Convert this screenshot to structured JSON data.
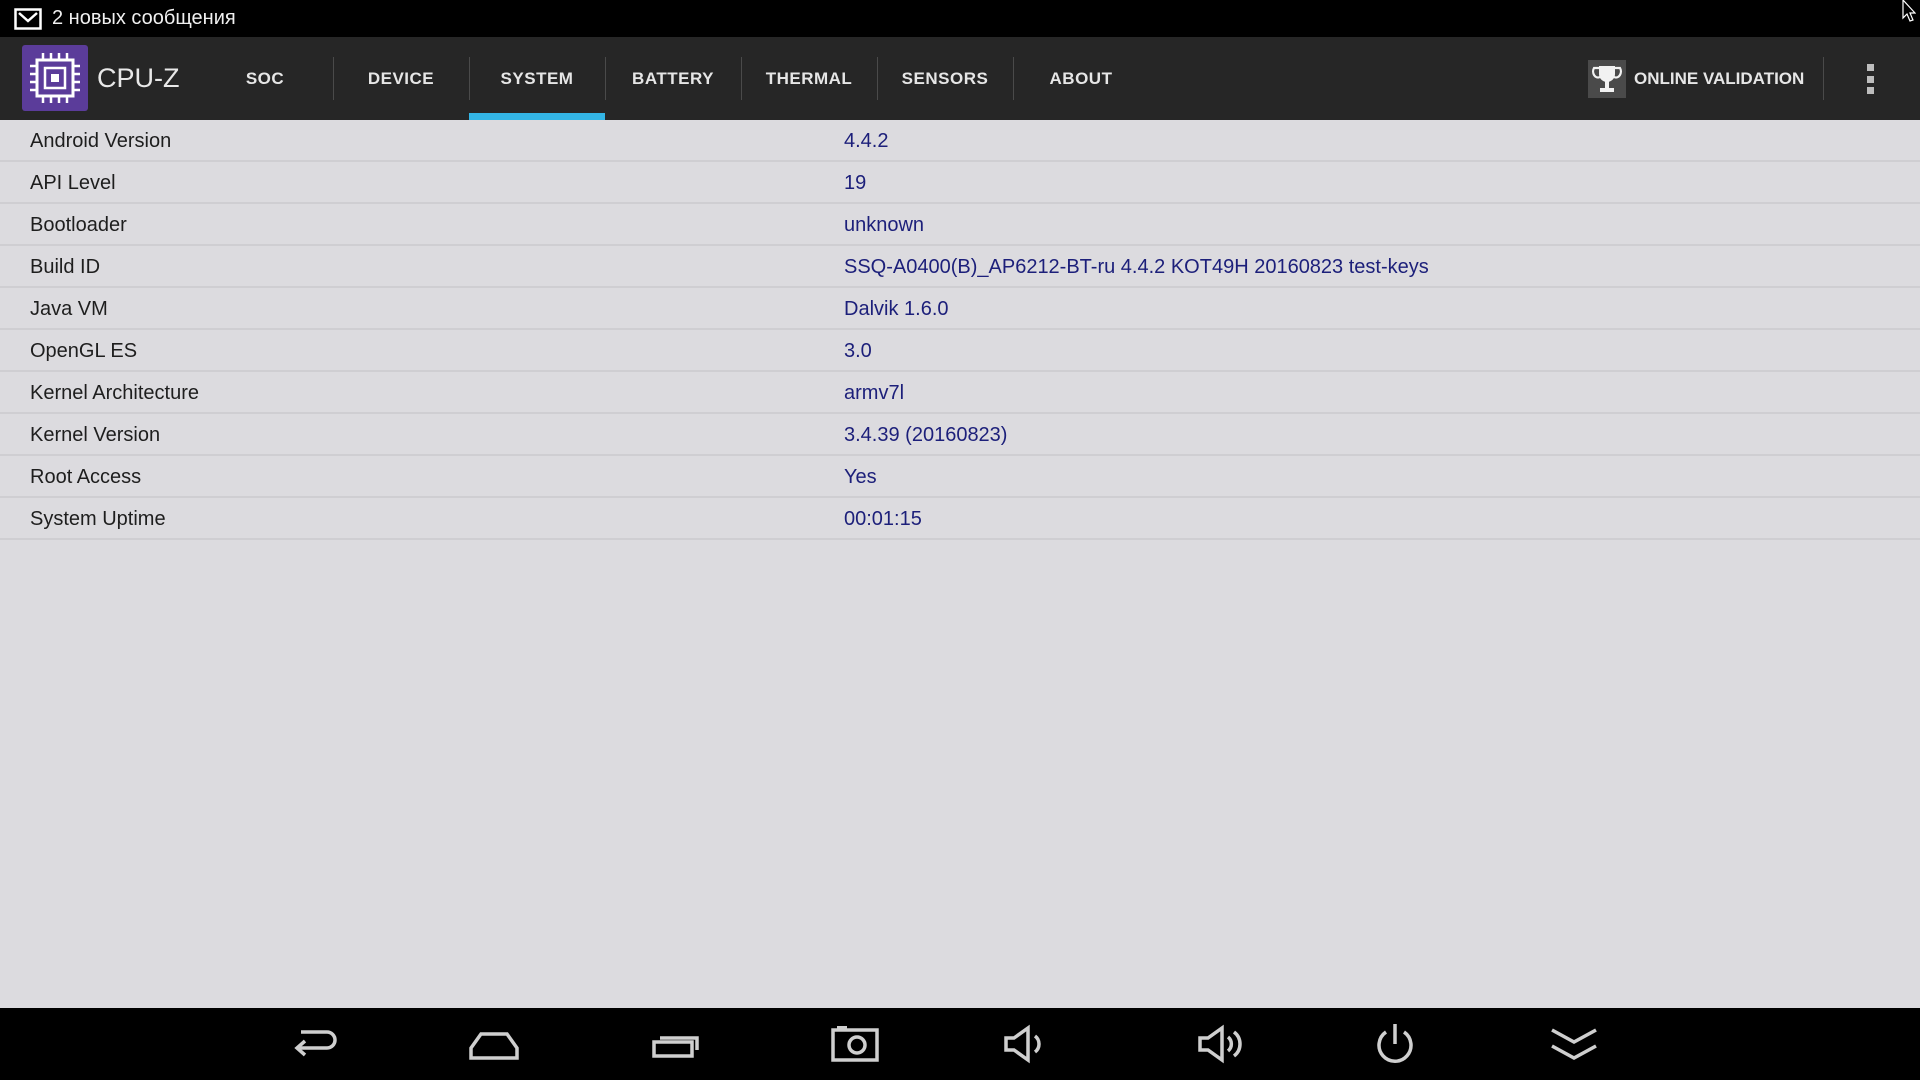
{
  "status_bar": {
    "notification_text": "2 новых сообщения"
  },
  "app": {
    "title": "CPU-Z",
    "accent_color": "#33b5e5"
  },
  "tabs": [
    {
      "label": "SOC",
      "active": false
    },
    {
      "label": "DEVICE",
      "active": false
    },
    {
      "label": "SYSTEM",
      "active": true
    },
    {
      "label": "BATTERY",
      "active": false
    },
    {
      "label": "THERMAL",
      "active": false
    },
    {
      "label": "SENSORS",
      "active": false
    },
    {
      "label": "ABOUT",
      "active": false
    }
  ],
  "actions": {
    "validation_label": "ONLINE VALIDATION"
  },
  "system_info": [
    {
      "label": "Android Version",
      "value": "4.4.2"
    },
    {
      "label": "API Level",
      "value": "19"
    },
    {
      "label": "Bootloader",
      "value": "unknown"
    },
    {
      "label": "Build ID",
      "value": "SSQ-A0400(B)_AP6212-BT-ru 4.4.2 KOT49H 20160823 test-keys"
    },
    {
      "label": "Java VM",
      "value": "Dalvik 1.6.0"
    },
    {
      "label": "OpenGL ES",
      "value": "3.0"
    },
    {
      "label": "Kernel Architecture",
      "value": "armv7l"
    },
    {
      "label": "Kernel Version",
      "value": "3.4.39 (20160823)"
    },
    {
      "label": "Root Access",
      "value": "Yes"
    },
    {
      "label": "System Uptime",
      "value": "00:01:15"
    }
  ],
  "nav_icons": [
    "back-icon",
    "home-icon",
    "recent-apps-icon",
    "screenshot-icon",
    "volume-down-icon",
    "volume-up-icon",
    "power-icon",
    "hide-bar-icon"
  ]
}
